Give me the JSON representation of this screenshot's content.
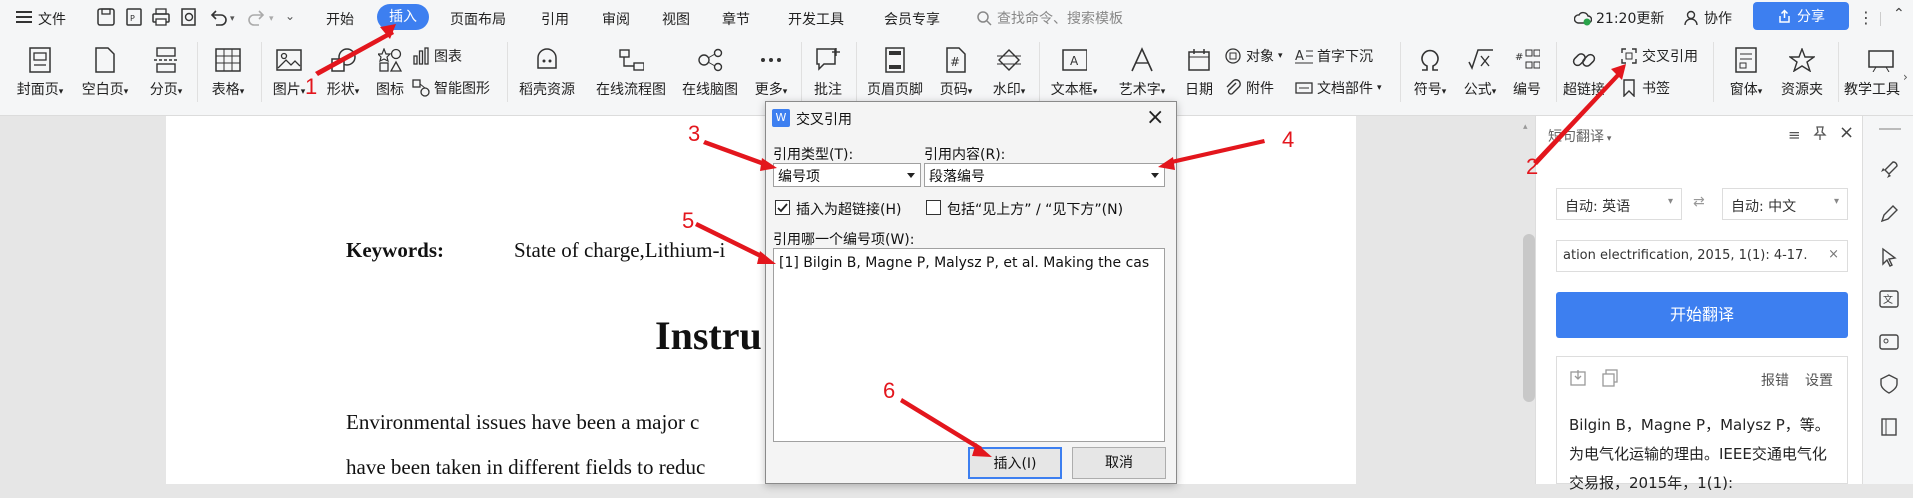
{
  "menubar": {
    "file": "文件",
    "tabs": [
      "开始",
      "插入",
      "页面布局",
      "引用",
      "审阅",
      "视图",
      "章节",
      "开发工具",
      "会员专享"
    ],
    "active_tab": "插入",
    "search_placeholder": "查找命令、搜索模板",
    "sync": "21:20更新",
    "collab": "协作",
    "share": "分享"
  },
  "ribbon": {
    "cover": "封面页",
    "blank": "空白页",
    "break": "分页",
    "table": "表格",
    "picture": "图片",
    "shape": "形状",
    "icon": "图标",
    "chart": "图表",
    "smartart": "智能图形",
    "docer": "稻壳资源",
    "flowchart": "在线流程图",
    "mindmap": "在线脑图",
    "more": "更多",
    "comment": "批注",
    "header_footer": "页眉页脚",
    "page_num": "页码",
    "watermark": "水印",
    "textbox": "文本框",
    "wordart": "艺术字",
    "date": "日期",
    "object": "对象",
    "dropcap": "首字下沉",
    "attachment": "附件",
    "docparts": "文档部件",
    "symbol": "符号",
    "formula": "公式",
    "numbering": "编号",
    "hyperlink": "超链接",
    "crossref": "交叉引用",
    "bookmark": "书签",
    "form": "窗体",
    "resource": "资源夹",
    "teaching": "教学工具"
  },
  "document": {
    "keywords_label": "Keywords:",
    "keywords_value": "State of charge,Lithium-i",
    "heading": "Instru",
    "line1": "Environmental  issues  have  been  a  major  c",
    "line2": "have been taken in different fields to reduc"
  },
  "dialog": {
    "title": "交叉引用",
    "ref_type_label": "引用类型(T):",
    "ref_type_value": "编号项",
    "ref_content_label": "引用内容(R):",
    "ref_content_value": "段落编号",
    "insert_hyperlink": "插入为超链接(H)",
    "include_above_below": "包括“见上方” / “见下方”(N)",
    "which_item_label": "引用哪一个编号项(W):",
    "items": [
      "[1] Bilgin B, Magne P, Malysz P, et al. Making the cas"
    ],
    "insert_button": "插入(I)",
    "cancel_button": "取消"
  },
  "translate_panel": {
    "title": "短句翻译",
    "src_lang": "自动: 英语",
    "dst_lang": "自动: 中文",
    "input": "ation electrification, 2015, 1(1): 4-17.",
    "start": "开始翻译",
    "report": "报错",
    "settings": "设置",
    "result": "Bilgin B，Magne P，Malysz P，等。为电气化运输的理由。IEEE交通电气化交易报，2015年，1(1):"
  },
  "annotations": [
    "1",
    "2",
    "3",
    "4",
    "5",
    "6"
  ],
  "colors": {
    "accent": "#3d7ff0",
    "arrow": "#e3161d"
  }
}
